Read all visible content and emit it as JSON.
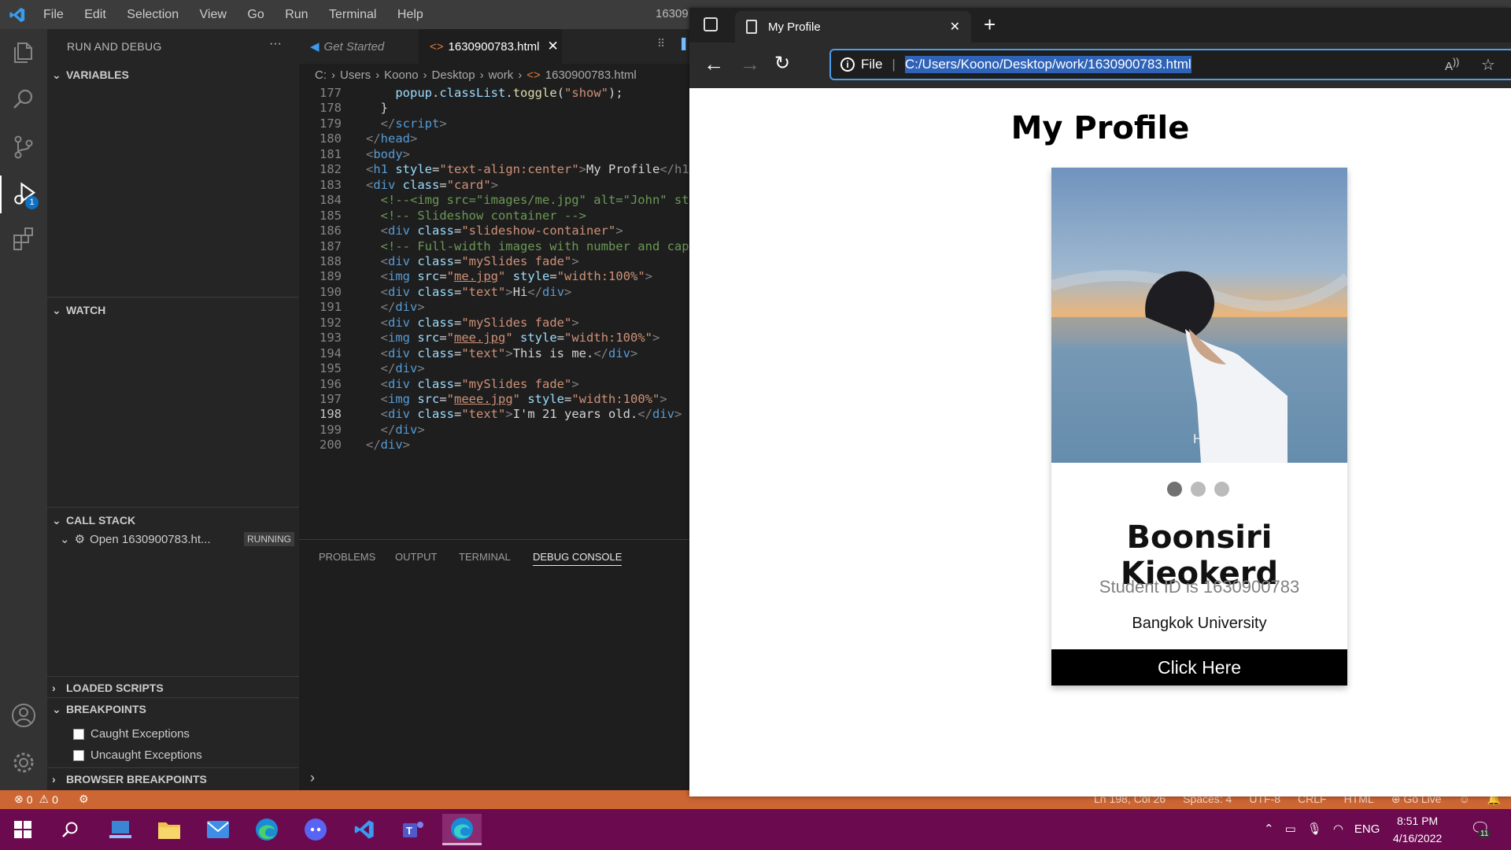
{
  "window": {
    "title": "16309",
    "menu": [
      "File",
      "Edit",
      "Selection",
      "View",
      "Go",
      "Run",
      "Terminal",
      "Help"
    ]
  },
  "activity_bar": {
    "icons": [
      "explorer-icon",
      "search-icon",
      "source-control-icon",
      "run-debug-icon",
      "extensions-icon",
      "account-icon",
      "settings-gear-icon"
    ],
    "debug_badge": "1"
  },
  "sidebar": {
    "title": "RUN AND DEBUG",
    "more": "···",
    "variables": "VARIABLES",
    "watch": "WATCH",
    "call_stack": "CALL STACK",
    "call_stack_item": "Open 1630900783.ht...",
    "call_stack_status": "RUNNING",
    "loaded_scripts": "LOADED SCRIPTS",
    "breakpoints": "BREAKPOINTS",
    "caught": "Caught Exceptions",
    "uncaught": "Uncaught Exceptions",
    "browser_breakpoints": "BROWSER BREAKPOINTS"
  },
  "editor": {
    "tabs": [
      {
        "label": "Get Started"
      },
      {
        "label": "1630900783.html"
      }
    ],
    "breadcrumb": [
      "C:",
      "Users",
      "Koono",
      "Desktop",
      "work",
      "1630900783.html"
    ],
    "current_line": "198",
    "line_numbers": [
      "177",
      "178",
      "179",
      "180",
      "181",
      "182",
      "183",
      "184",
      "185",
      "186",
      "187",
      "188",
      "189",
      "190",
      "191",
      "192",
      "193",
      "194",
      "195",
      "196",
      "197",
      "198",
      "199",
      "200"
    ]
  },
  "panel": {
    "tabs": [
      "PROBLEMS",
      "OUTPUT",
      "TERMINAL",
      "DEBUG CONSOLE"
    ],
    "active": "DEBUG CONSOLE"
  },
  "statusbar": {
    "errors": "0",
    "warnings": "0",
    "position": "Ln 198, Col 26",
    "spaces": "Spaces: 4",
    "encoding": "UTF-8",
    "eol": "CRLF",
    "language": "HTML",
    "golive": "Go Live"
  },
  "browser": {
    "tab_title": "My Profile",
    "address_scheme": "File",
    "address": "C:/Users/Koono/Desktop/work/1630900783.html",
    "page": {
      "heading": "My Profile",
      "caption": "Hi",
      "name": "Boonsiri Kieokerd",
      "student_id": "Student ID is 1630900783",
      "university": "Bangkok University",
      "button": "Click Here",
      "active_dot": 1,
      "dot_count": 3
    }
  },
  "taskbar": {
    "apps": [
      "start-icon",
      "search-icon",
      "task-app-icon",
      "file-explorer-icon",
      "mail-icon",
      "edge-icon",
      "discord-icon",
      "vscode-icon",
      "teams-icon",
      "edge-dev-icon"
    ],
    "lang": "ENG",
    "time": "8:51 PM",
    "date": "4/16/2022",
    "notifications": "11"
  }
}
